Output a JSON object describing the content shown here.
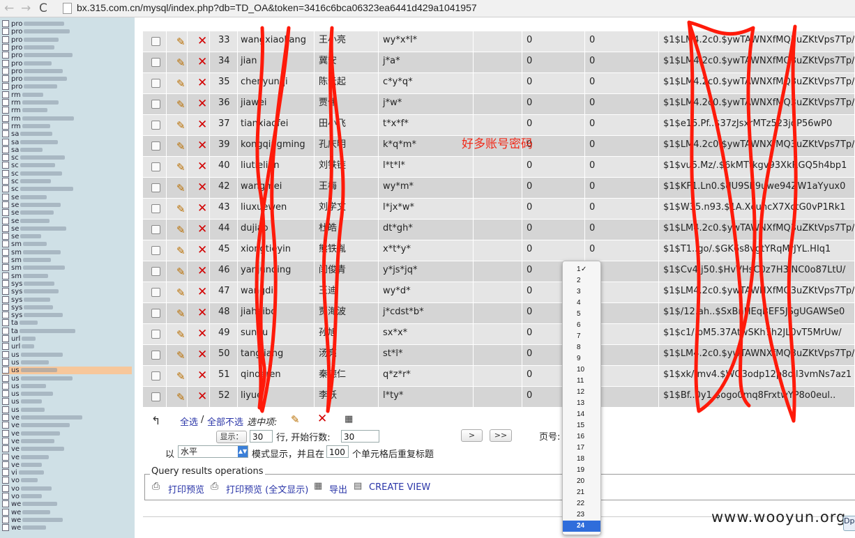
{
  "browser": {
    "url": "bx.315.com.cn/mysql/index.php?db=TD_OA&token=3416c6bca06323ea6441d429a1041957",
    "back_glyph": "←",
    "forward_glyph": "→",
    "reload_glyph": "C"
  },
  "sidebar": {
    "items": [
      "pro",
      "pro",
      "pro",
      "pro",
      "pro",
      "pro",
      "pro",
      "pro",
      "pro",
      "rm",
      "rm",
      "rm",
      "rm",
      "rm",
      "sa",
      "sa",
      "sa",
      "sc",
      "sc",
      "sc",
      "sc",
      "sc",
      "se",
      "se",
      "se",
      "se",
      "se",
      "se",
      "sm",
      "sm",
      "sm",
      "sm",
      "sm",
      "sys",
      "sys",
      "sys",
      "sys",
      "sys",
      "ta",
      "ta",
      "url",
      "url",
      "us",
      "us",
      "us",
      "us",
      "us",
      "us",
      "us",
      "us",
      "ve",
      "ve",
      "ve",
      "ve",
      "ve",
      "ve",
      "ve",
      "vi",
      "vo",
      "vo",
      "vo",
      "we",
      "we",
      "we",
      "we"
    ],
    "active_index": 44
  },
  "rows": [
    {
      "id": "33",
      "user_id": "wangxiaoliang",
      "name": "王小亮",
      "byname": "wy*x*l*",
      "c1": "0",
      "c2": "0",
      "hash": "$1$LM4.2c0.$ywTAWNXfMQ3uZKtVps7Tp/"
    },
    {
      "id": "34",
      "user_id": "jian",
      "name": "冀安",
      "byname": "j*a*",
      "c1": "0",
      "c2": "0",
      "hash": "$1$LM4.2c0.$ywTAWNXfMQ3uZKtVps7Tp/"
    },
    {
      "id": "35",
      "user_id": "chenyunqi",
      "name": "陈云起",
      "byname": "c*y*q*",
      "c1": "0",
      "c2": "0",
      "hash": "$1$LM4.2c0.$ywTAWNXfMQ3uZKtVps7Tp/"
    },
    {
      "id": "36",
      "user_id": "jiawei",
      "name": "贾伟",
      "byname": "j*w*",
      "c1": "0",
      "c2": "0",
      "hash": "$1$LM4.2c0.$ywTAWNXfMQ3uZKtVps7Tp/"
    },
    {
      "id": "37",
      "user_id": "tianxiaofei",
      "name": "田小飞",
      "byname": "t*x*f*",
      "c1": "0",
      "c2": "0",
      "hash": "$1$e15.Pf..$37zJsxrMTz523jdP56wP0"
    },
    {
      "id": "39",
      "user_id": "kongqingming",
      "name": "孔庆明",
      "byname": "k*q*m*",
      "c1": "0",
      "c2": "0",
      "hash": "$1$LM4.2c0.$ywTAWNXfMQ3uZKtVps7Tp/"
    },
    {
      "id": "40",
      "user_id": "liutielian",
      "name": "刘铁链",
      "byname": "l*t*l*",
      "c1": "0",
      "c2": "0",
      "hash": "$1$vu5.Mz/.$6kMTtkgv93XkRGQ5h4bp1"
    },
    {
      "id": "42",
      "user_id": "wangmei",
      "name": "王梅",
      "byname": "wy*m*",
      "c1": "0",
      "c2": "0",
      "hash": "$1$KF1.Ln0.$dU9SE9uwe94ZW1aYyux0"
    },
    {
      "id": "43",
      "user_id": "liuxuewen",
      "name": "刘学文",
      "byname": "l*jx*w*",
      "c1": "0",
      "c2": "0",
      "hash": "$1$W35.n93.$1A.XcuncX7XctG0vP1Rk1"
    },
    {
      "id": "44",
      "user_id": "dujiao",
      "name": "杜皓",
      "byname": "dt*gh*",
      "c1": "0",
      "c2": "0",
      "hash": "$1$LM4.2c0.$ywTAWNXfMQ3uZKtVps7Tp/"
    },
    {
      "id": "45",
      "user_id": "xiongtieyin",
      "name": "熊铁胤",
      "byname": "x*t*y*",
      "c1": "0",
      "c2": "0",
      "hash": "$1$T1..go/.$GK6s8vgtYRqMrJYL.HIq1"
    },
    {
      "id": "46",
      "user_id": "yanjunqing",
      "name": "闫俊青",
      "byname": "y*js*jq*",
      "c1": "0",
      "c2": "",
      "hash": "$1$Cv4.j50.$HvVHsC0z7H3lNC0o87LtU/"
    },
    {
      "id": "47",
      "user_id": "wangdi",
      "name": "王迪",
      "byname": "wy*d*",
      "c1": "0",
      "c2": "",
      "hash": "$1$LM4.2c0.$ywTAWNXfMQ3uZKtVps7Tp/"
    },
    {
      "id": "48",
      "user_id": "jiahaibo",
      "name": "贾海波",
      "byname": "j*cdst*b*",
      "c1": "0",
      "c2": "",
      "hash": "$1$/12.ah..$SxBnHEqBEF5JSgUGAWSe0"
    },
    {
      "id": "49",
      "user_id": "sunxu",
      "name": "孙旭",
      "byname": "sx*x*",
      "c1": "0",
      "c2": "",
      "hash": "$1$c1/.bM5.37AtwSKh7h2JL0vT5MrUw/"
    },
    {
      "id": "50",
      "user_id": "tangliang",
      "name": "汤亮",
      "byname": "st*l*",
      "c1": "0",
      "c2": "",
      "hash": "$1$LM4.2c0.$ywTAWNXfMQ3uZKtVps7Tp/"
    },
    {
      "id": "51",
      "user_id": "qinderen",
      "name": "秦德仁",
      "byname": "q*z*r*",
      "c1": "0",
      "c2": "",
      "hash": "$1$xk/.mv4.$WQ3odp12p8ojl3vmNs7az1"
    },
    {
      "id": "52",
      "user_id": "liyue",
      "name": "李跃",
      "byname": "l*ty*",
      "c1": "0",
      "c2": "",
      "hash": "$1$Bf..0y1.$ogo0mq8FrxtwYP8o0eul.."
    }
  ],
  "bulk": {
    "select_all": "全选",
    "separator": "/",
    "deselect_all": "全部不选",
    "selected_label": "选中项:"
  },
  "paging": {
    "show_btn": "显示：",
    "rows_value": "30",
    "rows_label": "行, 开始行数:",
    "start_value": "30",
    "next_btn": ">",
    "last_btn": ">>",
    "page_label": "页号:",
    "mode_prefix": "以",
    "mode_value": "水平",
    "mode_suffix": "模式显示，并且在",
    "repeat_value": "100",
    "repeat_suffix": "个单元格后重复标题"
  },
  "query_ops": {
    "legend": "Query results operations",
    "print_preview": "打印预览",
    "print_preview_full": "打印预览 (全文显示)",
    "export": "导出",
    "create_view": "CREATE VIEW"
  },
  "page_dropdown": {
    "options": [
      "1",
      "2",
      "3",
      "4",
      "5",
      "6",
      "7",
      "8",
      "9",
      "10",
      "11",
      "12",
      "13",
      "14",
      "15",
      "16",
      "17",
      "18",
      "19",
      "20",
      "21",
      "22",
      "23",
      "24"
    ],
    "checked": "1",
    "highlighted": "24",
    "check_glyph": "✓"
  },
  "annotation": "好多账号密码",
  "watermark": "www.wooyun.org",
  "badge_text": "Dp",
  "colors": {
    "scribble": "#ff1a0a",
    "sidebar_bg": "#cfe0e6",
    "active_item": "#f7c79b",
    "highlight": "#2f6ddb"
  }
}
